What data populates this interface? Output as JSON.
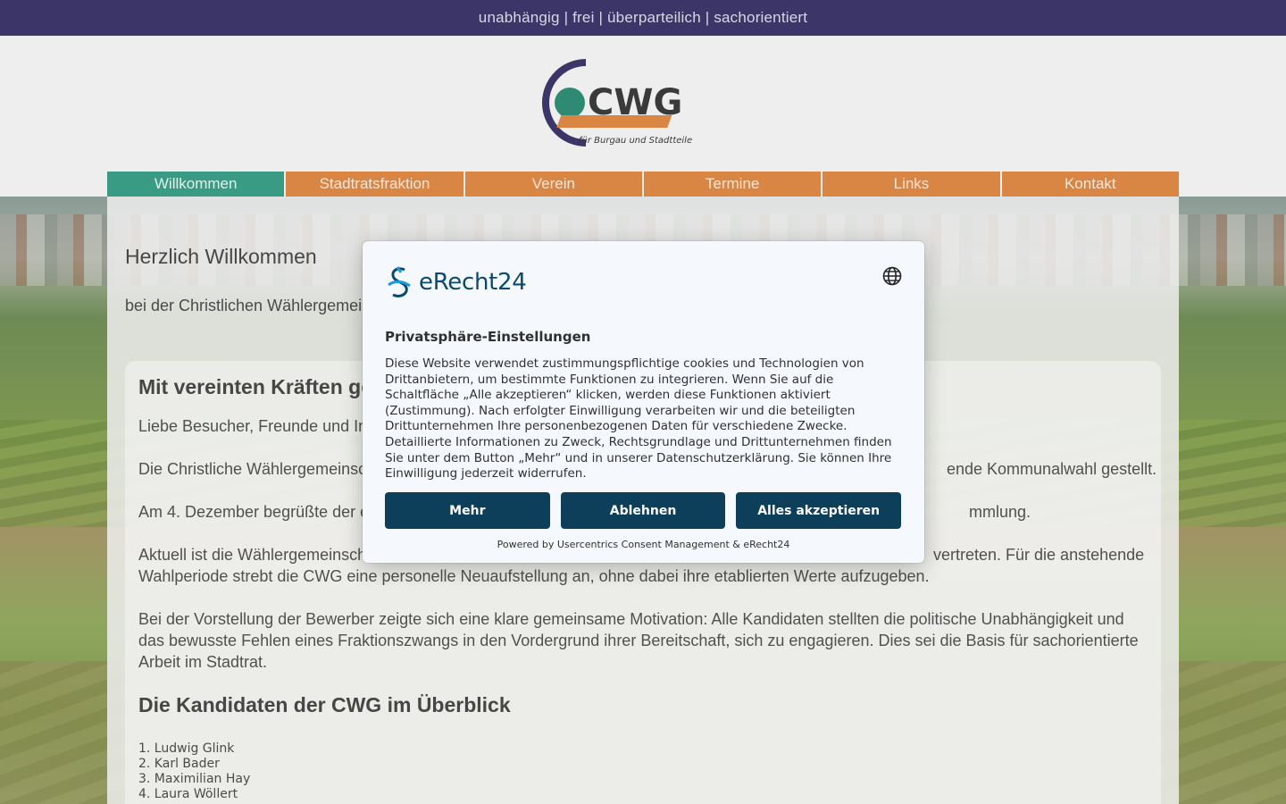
{
  "topbar": {
    "tagline": "unabhängig | frei | überparteilich | sachorientiert"
  },
  "logo": {
    "text": "CWG",
    "subtitle": "für Burgau und Stadtteile"
  },
  "nav": {
    "items": [
      {
        "label": "Willkommen",
        "active": true
      },
      {
        "label": "Stadtratsfraktion",
        "active": false
      },
      {
        "label": "Verein",
        "active": false
      },
      {
        "label": "Termine",
        "active": false
      },
      {
        "label": "Links",
        "active": false
      },
      {
        "label": "Kontakt",
        "active": false
      }
    ]
  },
  "main": {
    "heading": "Herzlich Willkommen",
    "intro": "bei der Christlichen Wählergemeins",
    "card": {
      "title": "Mit vereinten Kräften geht e",
      "p1": "Liebe Besucher, Freunde und Inte",
      "p2_left": "Die Christliche Wählergemeinscha",
      "p2_right": "ende Kommunalwahl gestellt.",
      "p3_left": "Am 4. Dezember begrüßte der ers",
      "p3_right": "mmlung.",
      "p4_left": "Aktuell ist die Wählergemeinscha",
      "p4_right": "vertreten. Für die anstehende",
      "p4_line2": "Wahlperiode strebt die CWG eine personelle Neuaufstellung an, ohne dabei ihre etablierten Werte aufzugeben.",
      "p5": "Bei der Vorstellung der Bewerber zeigte sich eine klare gemeinsame Motivation: Alle Kandidaten stellten die politische Unabhängigkeit und das bewusste Fehlen eines Fraktionszwangs in den Vordergrund ihrer Bereitschaft, sich zu engagieren. Dies sei die Basis für sachorientierte Arbeit im Stadtrat.",
      "subheading": "Die Kandidaten der CWG im Überblick",
      "candidates": [
        "1. Ludwig Glink",
        "2. Karl Bader",
        "3. Maximilian Hay",
        "4. Laura Wöllert"
      ]
    }
  },
  "consent": {
    "brand": "eRecht24",
    "title": "Privatsphäre-Einstellungen",
    "text": "Diese Website verwendet zustimmungspflichtige cookies und Technologien von Drittanbietern, um bestimmte Funktionen zu integrieren. Wenn Sie auf die Schaltfläche „Alle akzeptieren“ klicken, werden diese Funktionen aktiviert (Zustimmung). Nach erfolgter Einwilligung verarbeiten wir und die beteiligten Drittunternehmen Ihre personenbezogenen Daten für verschiedene Zwecke. Detaillierte Informationen zu Zweck, Rechtsgrundlage und Drittunternehmen finden Sie unter dem Button „Mehr“ und in unserer Datenschutzerklärung. Sie können Ihre Einwilligung jederzeit widerrufen.",
    "buttons": {
      "more": "Mehr",
      "decline": "Ablehnen",
      "accept": "Alles akzeptieren"
    },
    "powered": "Powered by Usercentrics Consent Management & eRecht24"
  },
  "colors": {
    "topbar": "#3c3568",
    "nav_active": "#3a9b85",
    "nav": "#d98544",
    "button": "#0d3f5a"
  }
}
